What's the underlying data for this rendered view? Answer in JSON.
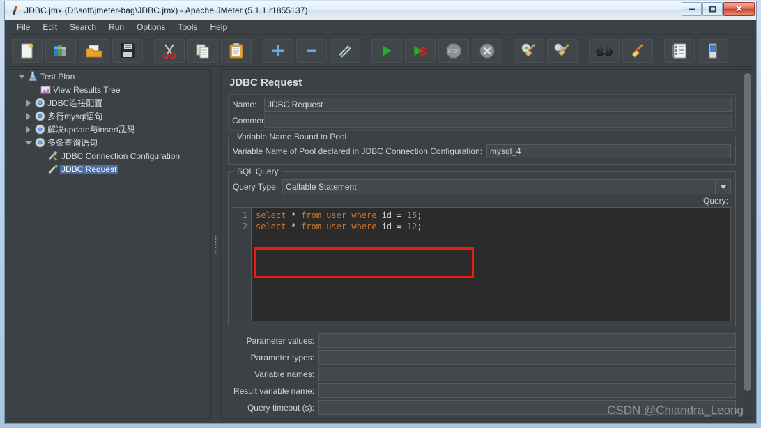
{
  "window": {
    "title": "JDBC.jmx (D:\\soft\\jmeter-bag\\JDBC.jmx) - Apache JMeter (5.1.1 r1855137)",
    "icon": "jmeter-feather-icon",
    "minimize_label": "–",
    "maximize_label": "□",
    "close_label": "✕"
  },
  "menu": {
    "items": [
      {
        "label": "File"
      },
      {
        "label": "Edit"
      },
      {
        "label": "Search"
      },
      {
        "label": "Run"
      },
      {
        "label": "Options"
      },
      {
        "label": "Tools"
      },
      {
        "label": "Help"
      }
    ]
  },
  "toolbar": {
    "buttons": [
      {
        "name": "new-icon",
        "tip": "New"
      },
      {
        "name": "templates-icon",
        "tip": "Templates"
      },
      {
        "name": "open-folder-icon",
        "tip": "Open"
      },
      {
        "name": "save-icon",
        "tip": "Save Test Plan"
      },
      {
        "name": "cut-scissors-icon",
        "tip": "Cut"
      },
      {
        "name": "copy-icon",
        "tip": "Copy"
      },
      {
        "name": "paste-clipboard-icon",
        "tip": "Paste"
      },
      {
        "name": "expand-all-plus-icon",
        "tip": "Expand All"
      },
      {
        "name": "collapse-all-minus-icon",
        "tip": "Collapse All"
      },
      {
        "name": "toggle-icon",
        "tip": "Toggle"
      },
      {
        "name": "start-play-icon",
        "tip": "Start"
      },
      {
        "name": "start-no-pauses-icon",
        "tip": "Start no pauses"
      },
      {
        "name": "stop-icon",
        "tip": "Stop"
      },
      {
        "name": "shutdown-icon",
        "tip": "Shutdown"
      },
      {
        "name": "clear-gear-broom-icon",
        "tip": "Clear"
      },
      {
        "name": "clear-all-gears-broom-icon",
        "tip": "Clear All"
      },
      {
        "name": "search-binoculars-icon",
        "tip": "Search"
      },
      {
        "name": "reset-search-broom-icon",
        "tip": "Reset Search"
      },
      {
        "name": "function-helper-notepad-icon",
        "tip": "Function Helper Dialog"
      },
      {
        "name": "heap-memory-icon",
        "tip": "Heap"
      }
    ]
  },
  "tree": {
    "nodes": [
      {
        "label": "Test Plan",
        "icon": "test-plan-icon",
        "toggle": "expanded",
        "depth": 0,
        "selected": false
      },
      {
        "label": "View Results Tree",
        "icon": "view-results-tree-icon",
        "toggle": "none",
        "depth": 1,
        "selected": false
      },
      {
        "label": "JDBC连接配置",
        "icon": "config-gear-icon",
        "toggle": "collapsed",
        "depth": 1,
        "selected": false
      },
      {
        "label": "多行mysql语句",
        "icon": "config-gear-icon",
        "toggle": "collapsed",
        "depth": 1,
        "selected": false
      },
      {
        "label": "解决update与insert乱码",
        "icon": "config-gear-icon",
        "toggle": "collapsed",
        "depth": 1,
        "selected": false
      },
      {
        "label": "多条查询语句",
        "icon": "config-gear-icon",
        "toggle": "expanded",
        "depth": 1,
        "selected": false
      },
      {
        "label": "JDBC Connection Configuration",
        "icon": "jdbc-connection-config-icon",
        "toggle": "none",
        "depth": 2,
        "selected": false
      },
      {
        "label": "JDBC Request",
        "icon": "jdbc-request-icon",
        "toggle": "none",
        "depth": 2,
        "selected": true
      }
    ]
  },
  "main": {
    "title": "JDBC Request",
    "name_label": "Name:",
    "name_value": "JDBC Request",
    "comments_label": "Comments:",
    "comments_value": "",
    "pool_group_legend": "Variable Name Bound to Pool",
    "pool_label": "Variable Name of Pool declared in JDBC Connection Configuration:",
    "pool_value": "mysql_4",
    "sql_group_legend": "SQL Query",
    "query_type_label": "Query Type:",
    "query_type_value": "Callable Statement",
    "query_label": "Query:",
    "sql_lines": [
      {
        "num": "1",
        "tokens": [
          {
            "t": "select",
            "c": "k"
          },
          {
            "t": " ",
            "c": "p"
          },
          {
            "t": "*",
            "c": "p"
          },
          {
            "t": " ",
            "c": "p"
          },
          {
            "t": "from",
            "c": "k"
          },
          {
            "t": " ",
            "c": "p"
          },
          {
            "t": "user",
            "c": "k"
          },
          {
            "t": " ",
            "c": "p"
          },
          {
            "t": "where",
            "c": "k"
          },
          {
            "t": " ",
            "c": "p"
          },
          {
            "t": "id",
            "c": "id"
          },
          {
            "t": " ",
            "c": "p"
          },
          {
            "t": "=",
            "c": "p"
          },
          {
            "t": " ",
            "c": "p"
          },
          {
            "t": "15",
            "c": "n"
          },
          {
            "t": ";",
            "c": "p"
          }
        ]
      },
      {
        "num": "2",
        "tokens": [
          {
            "t": "select",
            "c": "k"
          },
          {
            "t": " ",
            "c": "p"
          },
          {
            "t": "*",
            "c": "p"
          },
          {
            "t": " ",
            "c": "p"
          },
          {
            "t": "from",
            "c": "k"
          },
          {
            "t": " ",
            "c": "p"
          },
          {
            "t": "user",
            "c": "k"
          },
          {
            "t": " ",
            "c": "p"
          },
          {
            "t": "where",
            "c": "k"
          },
          {
            "t": " ",
            "c": "p"
          },
          {
            "t": "id",
            "c": "id"
          },
          {
            "t": " ",
            "c": "p"
          },
          {
            "t": "=",
            "c": "p"
          },
          {
            "t": " ",
            "c": "p"
          },
          {
            "t": "12",
            "c": "n"
          },
          {
            "t": ";",
            "c": "p"
          }
        ]
      }
    ],
    "params": [
      {
        "label": "Parameter values:",
        "value": ""
      },
      {
        "label": "Parameter types:",
        "value": ""
      },
      {
        "label": "Variable names:",
        "value": ""
      },
      {
        "label": "Result variable name:",
        "value": ""
      },
      {
        "label": "Query timeout (s):",
        "value": ""
      }
    ]
  },
  "annotation": {
    "highlight_color": "#f01a10",
    "target": "query-type-row"
  },
  "watermark": {
    "text": "CSDN @Chiandra_Leong"
  },
  "colors": {
    "app_bg": "#3c4145",
    "field_bg": "#43484c",
    "text": "#cdd2d6",
    "selection": "#4a6fa5",
    "editor_bg": "#2b2b2b",
    "keyword": "#cc7832",
    "number": "#6897bb",
    "title_bar": "#e2ecf6"
  }
}
